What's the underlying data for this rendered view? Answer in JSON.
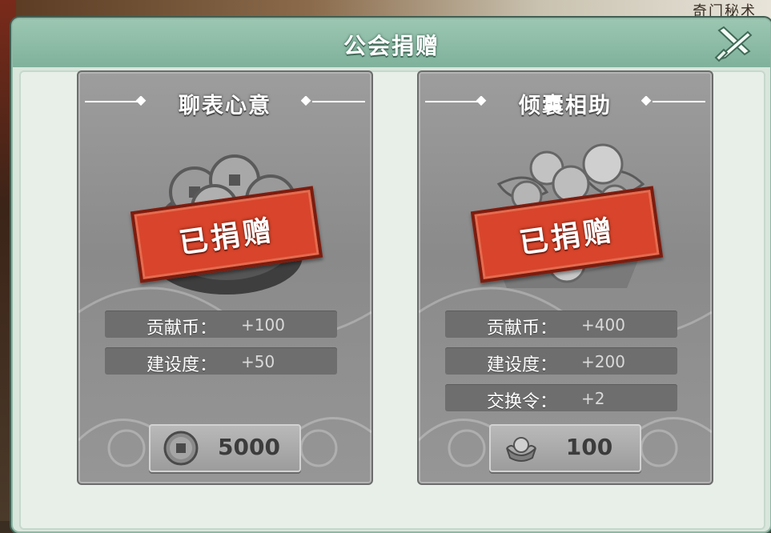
{
  "background": {
    "corner_text": "奇门秘术"
  },
  "dialog": {
    "title": "公会捐赠",
    "close_icon": "crossed-swords-close-icon"
  },
  "cards": [
    {
      "title": "聊表心意",
      "art_icon": "coin-pouch-icon",
      "stamp": "已捐赠",
      "rewards": [
        {
          "label": "贡献币：",
          "value": "+100"
        },
        {
          "label": "建设度：",
          "value": "+50"
        }
      ],
      "cost": {
        "icon": "copper-coin-icon",
        "value": "5000"
      }
    },
    {
      "title": "倾囊相助",
      "art_icon": "silver-ingot-pile-icon",
      "stamp": "已捐赠",
      "rewards": [
        {
          "label": "贡献币：",
          "value": "+400"
        },
        {
          "label": "建设度：",
          "value": "+200"
        },
        {
          "label": "交换令：",
          "value": "+2"
        }
      ],
      "cost": {
        "icon": "silver-ingot-icon",
        "value": "100"
      }
    }
  ]
}
